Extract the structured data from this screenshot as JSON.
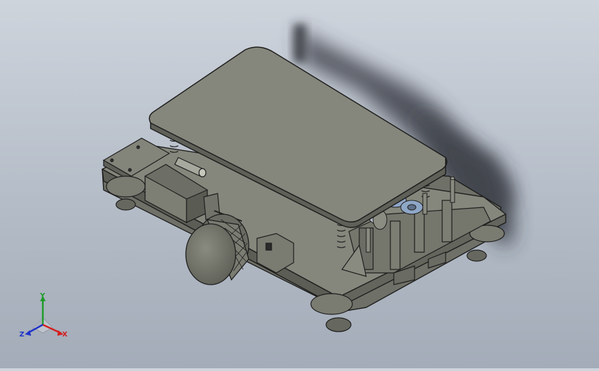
{
  "viewport": {
    "background_top": "#ced4dc",
    "background_bottom": "#a3acb8"
  },
  "model": {
    "body_color": "#7c7d72",
    "edge_color": "#1e1e1e",
    "gear_color": "#8fa7c7"
  },
  "triad": {
    "x_label": "X",
    "y_label": "Y",
    "z_label": "Z",
    "x_color": "#d42020",
    "y_color": "#1f9a2a",
    "z_color": "#2034c8"
  }
}
